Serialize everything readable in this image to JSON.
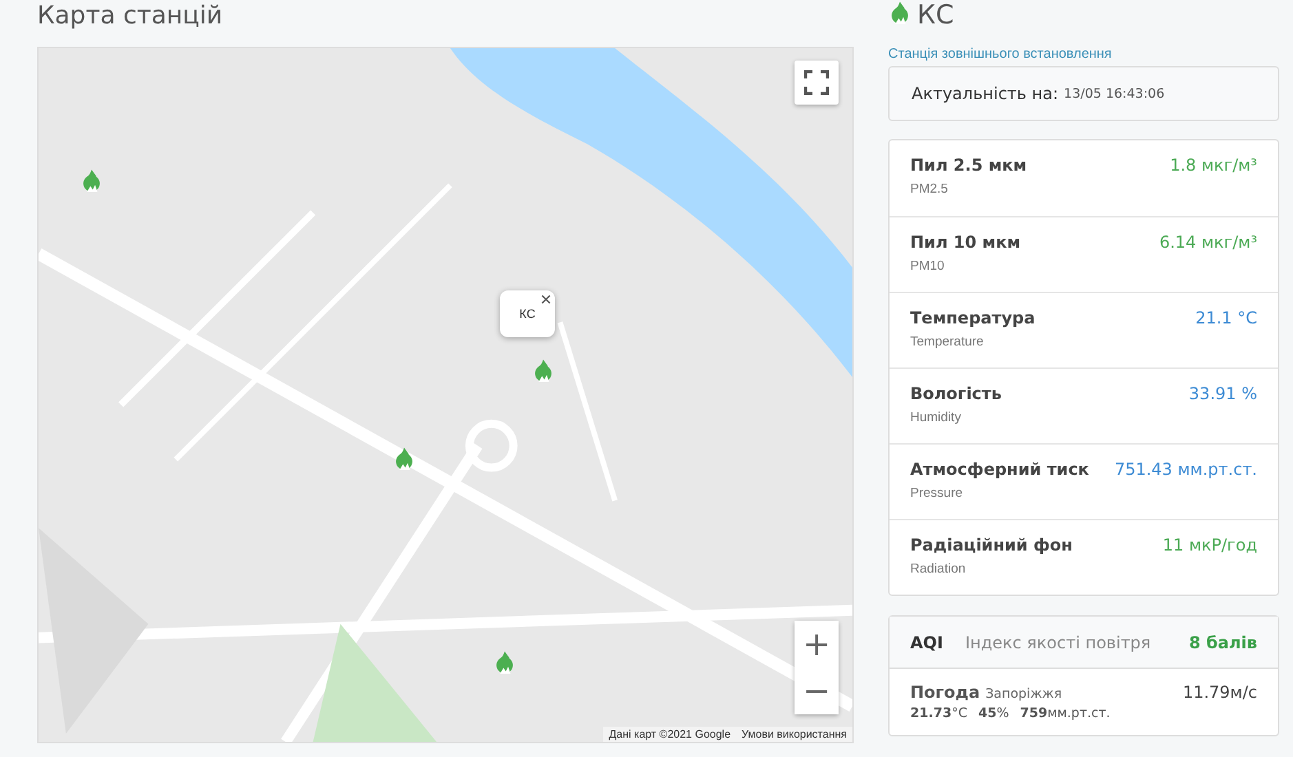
{
  "map_section": {
    "title": "Карта станцій",
    "popup": {
      "label": "КС"
    },
    "attribution": "Дані карт ©2021 Google",
    "terms_link": "Умови використання",
    "zoom_in": "+",
    "zoom_out": "−"
  },
  "station": {
    "name": "КС",
    "type": "Станція зовнішнього встановлення",
    "updated_label": "Актуальність на:",
    "updated_time": "13/05 16:43:06"
  },
  "measurements": [
    {
      "label": "Пил 2.5 мкм",
      "sublabel": "PM2.5",
      "value": "1.8 мкг/м³",
      "color": "#4caa55"
    },
    {
      "label": "Пил 10 мкм",
      "sublabel": "PM10",
      "value": "6.14 мкг/м³",
      "color": "#4caa55"
    },
    {
      "label": "Температура",
      "sublabel": "Temperature",
      "value": "21.1 °C",
      "color": "#3d8bd4"
    },
    {
      "label": "Вологість",
      "sublabel": "Humidity",
      "value": "33.91 %",
      "color": "#3d8bd4"
    },
    {
      "label": "Атмосферний тиск",
      "sublabel": "Pressure",
      "value": "751.43 мм.рт.ст.",
      "color": "#3d8bd4"
    },
    {
      "label": "Радіаційний фон",
      "sublabel": "Radiation",
      "value": "11 мкР/год",
      "color": "#4caa55"
    }
  ],
  "aqi": {
    "label": "AQI",
    "description": "Індекс якості повітря",
    "value": "8 балів",
    "color": "#3aa048"
  },
  "weather": {
    "label": "Погода",
    "city": "Запоріжжя",
    "wind": "11.79м/с",
    "temperature": "**21.73**°C",
    "humidity": "**45**%",
    "pressure": "**759**мм.рт.ст."
  }
}
